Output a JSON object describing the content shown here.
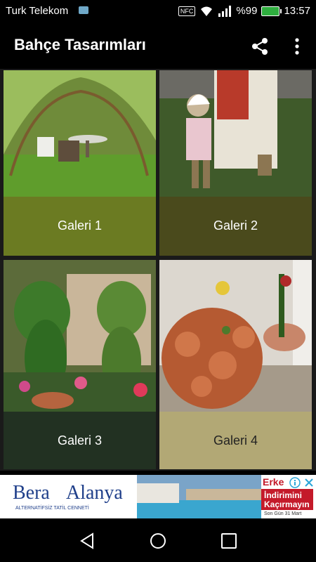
{
  "status": {
    "carrier": "Turk Telekom",
    "nfc": "NFC",
    "battery": "%99",
    "time": "13:57",
    "icons": [
      "sim-card-icon",
      "nfc-icon",
      "wifi-icon",
      "signal-icon",
      "battery-icon"
    ]
  },
  "app": {
    "title": "Bahçe Tasarımları",
    "actions": [
      "share-icon",
      "more-vert-icon"
    ]
  },
  "gallery": [
    {
      "label": "Galeri 1",
      "band_color": "#6b7b22"
    },
    {
      "label": "Galeri 2",
      "band_color": "#4a4a1c"
    },
    {
      "label": "Galeri 3",
      "band_color": "#223122"
    },
    {
      "label": "Galeri 4",
      "band_color": "#b2a875"
    }
  ],
  "ad": {
    "brand_left": "Bera",
    "brand_right": "Alanya",
    "tagline": "ALTERNATİFSİZ TATİL CENNETİ",
    "promo_title": "Erke",
    "promo_line1": "İndirimini",
    "promo_line2": "Kaçırmayın",
    "promo_footer": "Son Gün 31 Mart",
    "info_icon": "info-icon",
    "close_icon": "close-icon"
  },
  "nav": [
    "back-icon",
    "home-icon",
    "recents-icon"
  ]
}
